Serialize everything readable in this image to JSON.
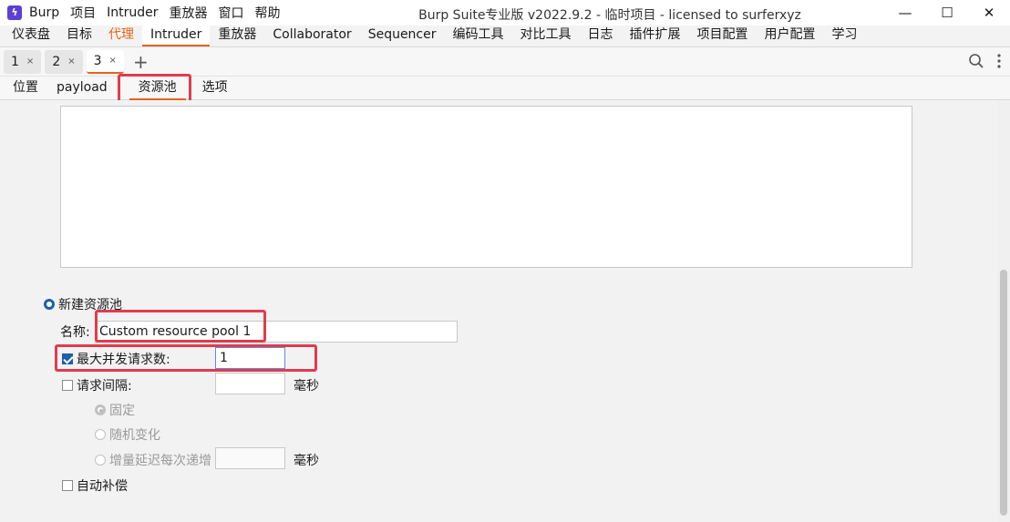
{
  "window": {
    "app_icon": "burp-logo-icon",
    "menu": [
      "Burp",
      "项目",
      "Intruder",
      "重放器",
      "窗口",
      "帮助"
    ],
    "title": "Burp Suite专业版  v2022.9.2 - 临时项目 - licensed to surferxyz",
    "controls": {
      "minimize": "—",
      "maximize": "☐",
      "close": "✕"
    }
  },
  "main_tabs": [
    "仪表盘",
    "目标",
    "代理",
    "Intruder",
    "重放器",
    "Collaborator",
    "Sequencer",
    "编码工具",
    "对比工具",
    "日志",
    "插件扩展",
    "项目配置",
    "用户配置",
    "学习"
  ],
  "attack_tabs": [
    {
      "label": "1",
      "close": "×"
    },
    {
      "label": "2",
      "close": "×"
    },
    {
      "label": "3",
      "close": "×"
    }
  ],
  "add_tab_label": "+",
  "inner_tabs": [
    "位置",
    "payload",
    "资源池",
    "选项"
  ],
  "pool": {
    "new_pool_label": "新建资源池",
    "name_label": "名称:",
    "name_value": "Custom resource pool 1",
    "max_concurrent_label": "最大并发请求数:",
    "max_concurrent_value": "1",
    "max_concurrent_checked": true,
    "delay_label": "请求间隔:",
    "delay_value": "",
    "ms_unit": "毫秒",
    "fixed_label": "固定",
    "random_label": "随机变化",
    "increase_label": "增量延迟每次递增",
    "increase_value": "",
    "auto_throttle_label": "自动补偿"
  },
  "colors": {
    "accent": "#e8621a",
    "highlight": "#e23b4e",
    "check": "#1f5fa8"
  }
}
